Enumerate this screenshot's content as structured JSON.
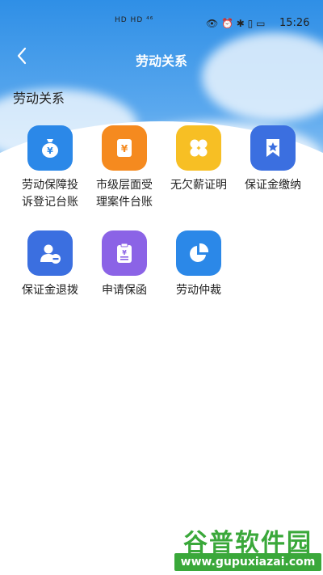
{
  "status_bar": {
    "signal": "HD HD ⁴⁶",
    "time": "15:26"
  },
  "header": {
    "title": "劳动关系"
  },
  "section": {
    "title": "劳动关系"
  },
  "items": [
    {
      "label_line1": "劳动保障投",
      "label_line2": "诉登记台账",
      "icon": "money-bag-icon",
      "color": "#2b88e8"
    },
    {
      "label_line1": "市级层面受",
      "label_line2": "理案件台账",
      "icon": "yuan-document-icon",
      "color": "#f58a1f"
    },
    {
      "label_line1": "无欠薪证明",
      "label_line2": "",
      "icon": "four-leaf-icon",
      "color": "#f7bf24"
    },
    {
      "label_line1": "保证金缴纳",
      "label_line2": "",
      "icon": "bookmark-star-icon",
      "color": "#3b6fe0"
    },
    {
      "label_line1": "保证金退拨",
      "label_line2": "",
      "icon": "user-minus-icon",
      "color": "#3b6fe0"
    },
    {
      "label_line1": "申请保函",
      "label_line2": "",
      "icon": "clipboard-yuan-icon",
      "color": "#8b63e6"
    },
    {
      "label_line1": "劳动仲裁",
      "label_line2": "",
      "icon": "pie-chart-icon",
      "color": "#2b88e8"
    }
  ],
  "watermark": {
    "name": "谷普软件园",
    "url": "www.gupuxiazai.com"
  }
}
